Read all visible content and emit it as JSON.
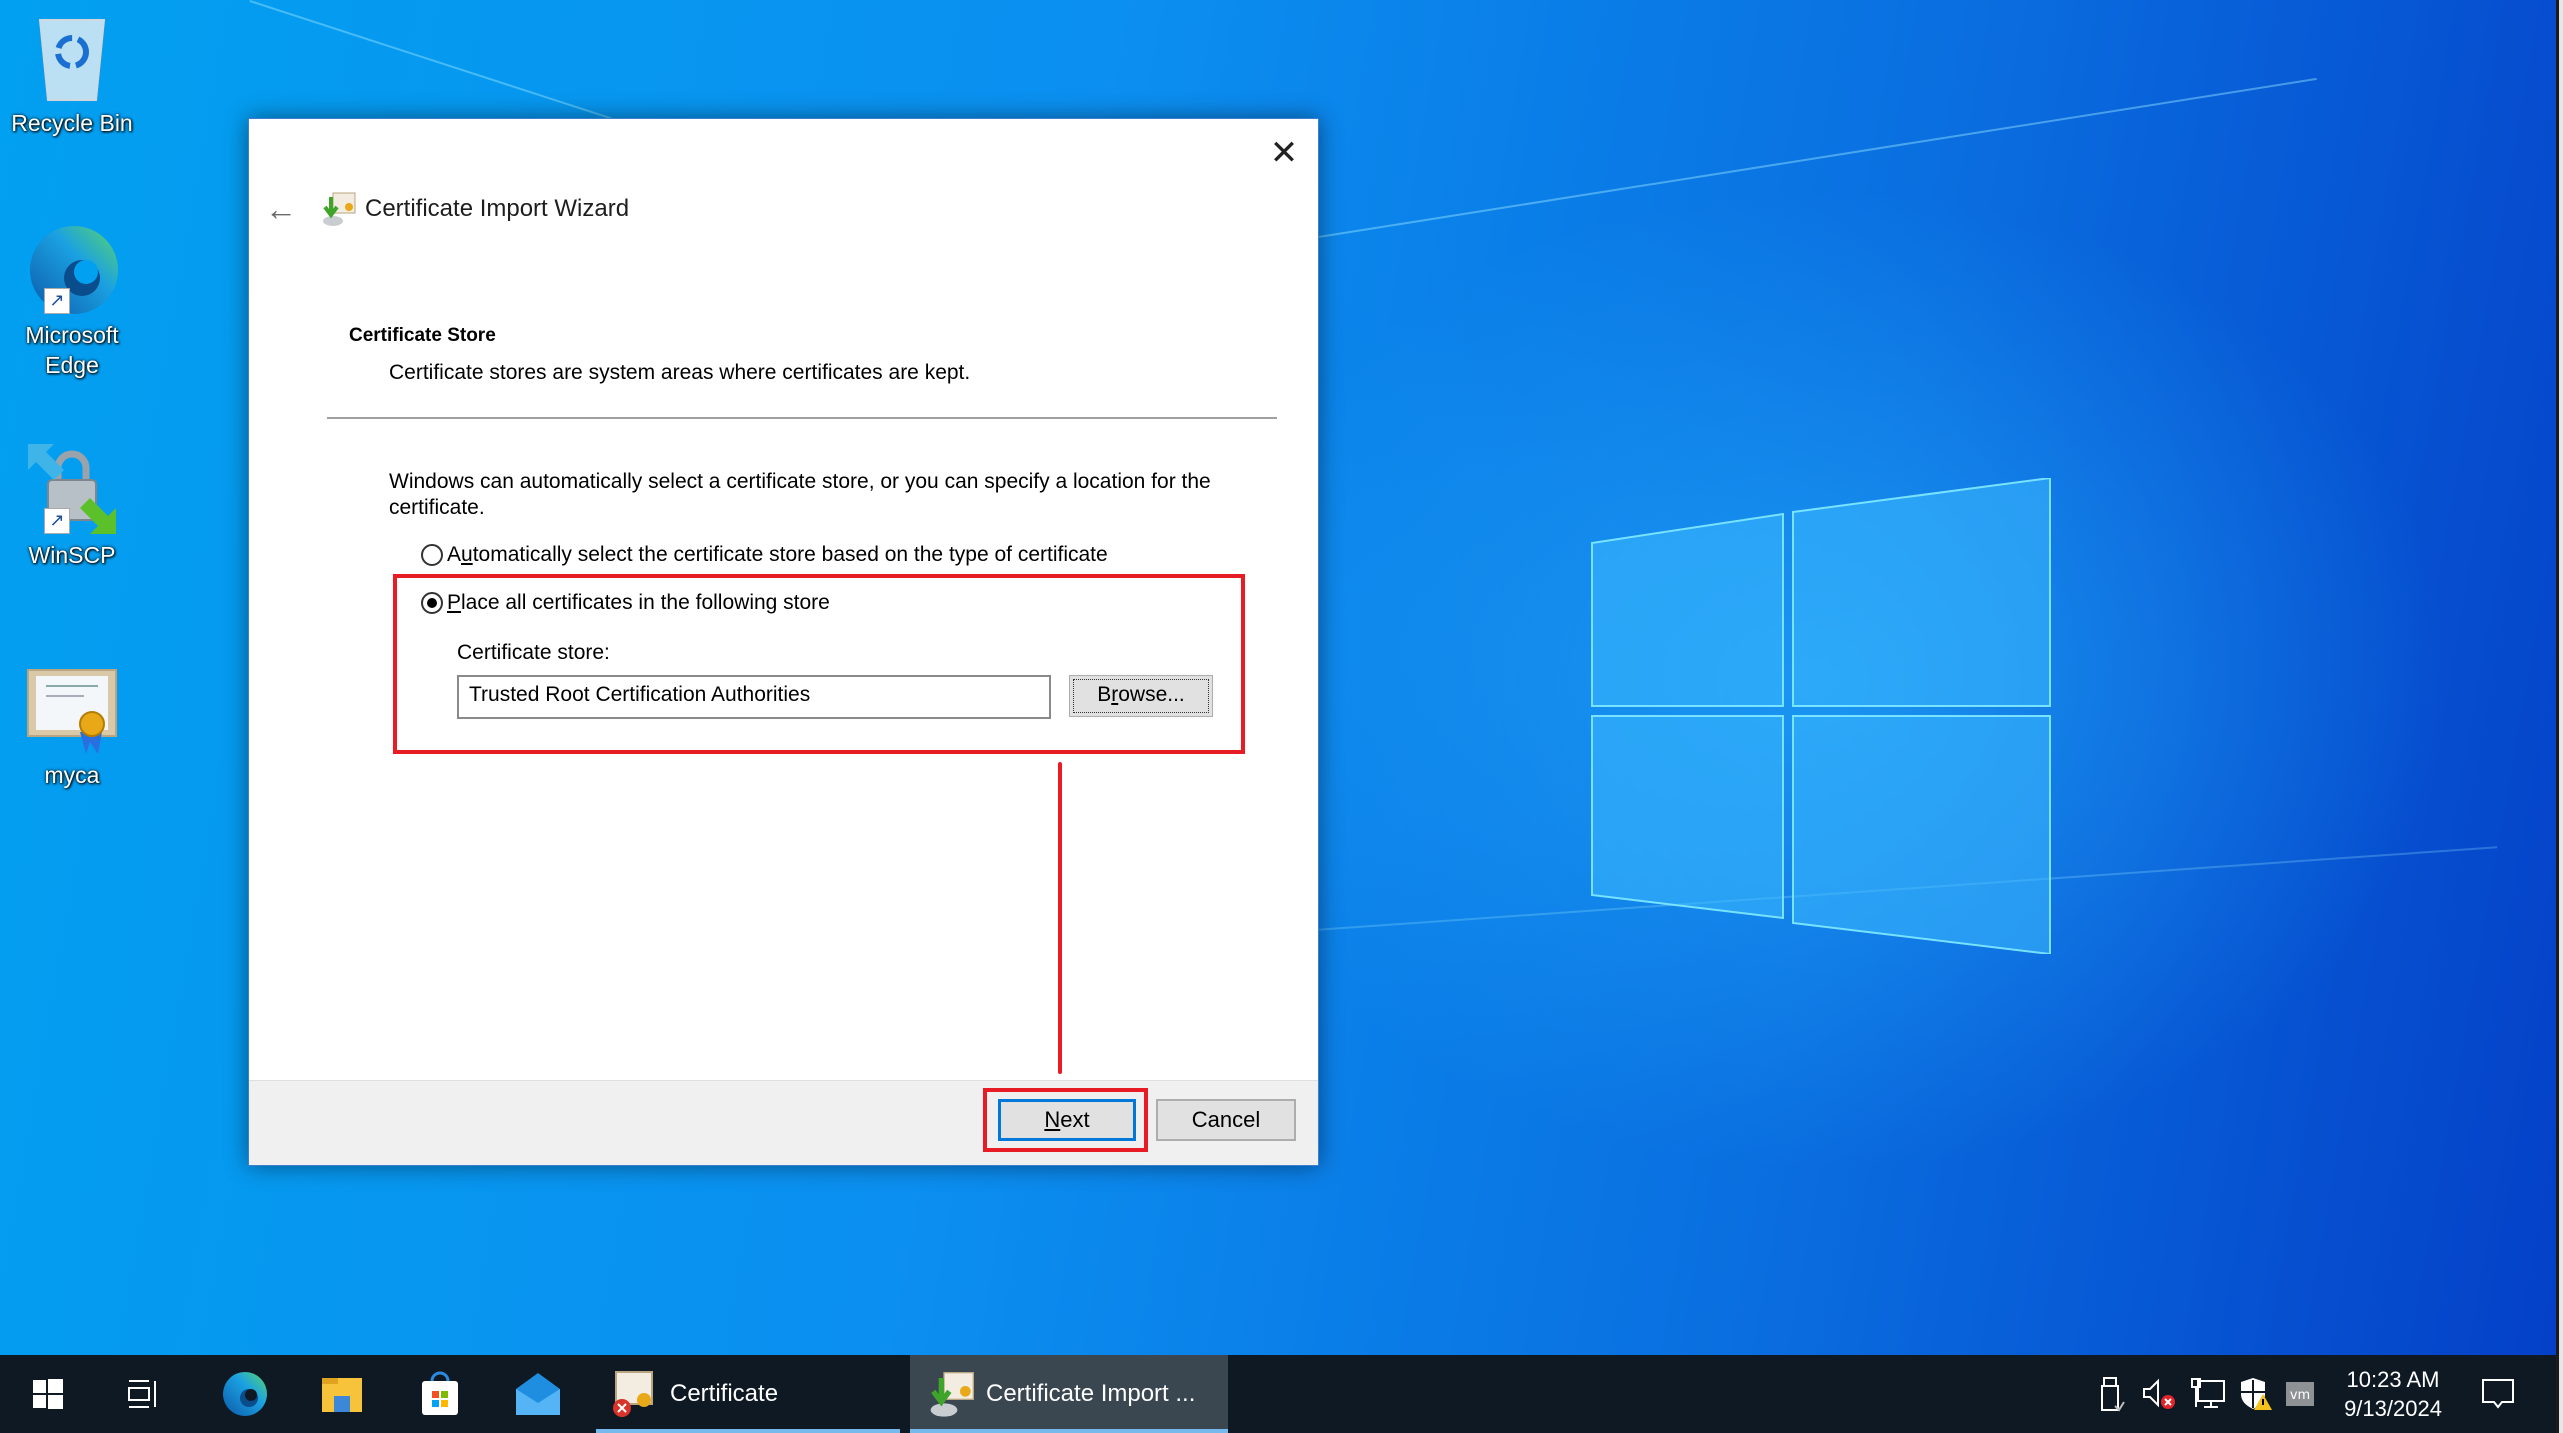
{
  "desktop": {
    "icons": [
      {
        "label": "Recycle Bin",
        "icon": "recycle-bin-icon"
      },
      {
        "label": "Microsoft Edge",
        "icon": "edge-icon",
        "shortcut": true
      },
      {
        "label": "WinSCP",
        "icon": "winscp-icon",
        "shortcut": true
      },
      {
        "label": "myca",
        "icon": "certificate-file-icon"
      }
    ]
  },
  "dialog": {
    "title": "Certificate Import Wizard",
    "close_glyph": "✕",
    "back_glyph": "←",
    "section_title": "Certificate Store",
    "section_desc": "Certificate stores are system areas where certificates are kept.",
    "intro": "Windows can automatically select a certificate store, or you can specify a location for the certificate.",
    "options": [
      {
        "label_prefix": "A",
        "label_underlined": "u",
        "label_rest": "tomatically select the certificate store based on the type of certificate",
        "checked": false
      },
      {
        "label_prefix": "",
        "label_underlined": "P",
        "label_rest": "lace all certificates in the following store",
        "checked": true
      }
    ],
    "store_label": "Certificate store:",
    "store_value": "Trusted Root Certification Authorities",
    "browse": {
      "prefix": "B",
      "underlined": "r",
      "rest": "owse..."
    },
    "next": {
      "underlined": "N",
      "rest": "ext"
    },
    "cancel_label": "Cancel"
  },
  "annotation": {
    "color": "#e81c24"
  },
  "taskbar": {
    "pinned": [
      "start-icon",
      "task-view-icon",
      "edge-icon",
      "file-explorer-icon",
      "store-icon",
      "mail-icon"
    ],
    "apps": [
      {
        "label": "Certificate",
        "active": false
      },
      {
        "label": "Certificate Import ...",
        "active": true
      }
    ],
    "tray": [
      "usb-eject-icon",
      "volume-muted-icon",
      "network-icon",
      "security-warning-icon",
      "vmware-tools-icon"
    ],
    "time": "10:23 AM",
    "date": "9/13/2024",
    "notifications_icon": "action-center-icon"
  }
}
